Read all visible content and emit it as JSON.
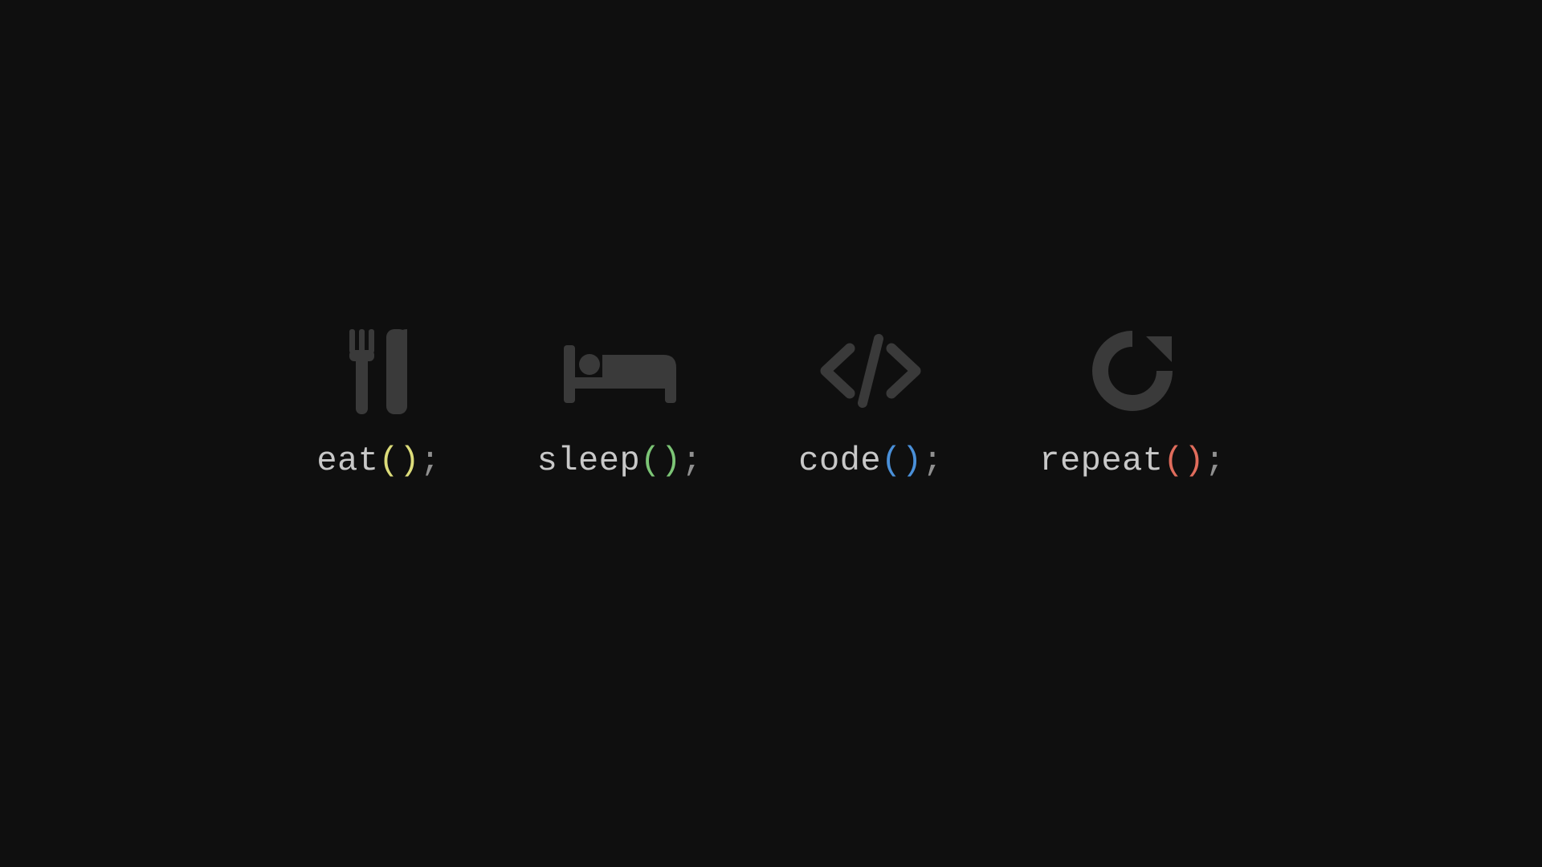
{
  "items": [
    {
      "fn": "eat",
      "parens": "()",
      "semi": ";",
      "paren_color": "#dcdc7a",
      "icon": "fork-knife-icon"
    },
    {
      "fn": "sleep",
      "parens": "()",
      "semi": ";",
      "paren_color": "#7cc576",
      "icon": "bed-icon"
    },
    {
      "fn": "code",
      "parens": "()",
      "semi": ";",
      "paren_color": "#4a90d9",
      "icon": "code-brackets-icon"
    },
    {
      "fn": "repeat",
      "parens": "()",
      "semi": ";",
      "paren_color": "#e06c5c",
      "icon": "refresh-icon"
    }
  ],
  "colors": {
    "background": "#0f0f0f",
    "icon": "#3a3a3a",
    "text": "#c8c8c8",
    "semicolon": "#909090"
  }
}
